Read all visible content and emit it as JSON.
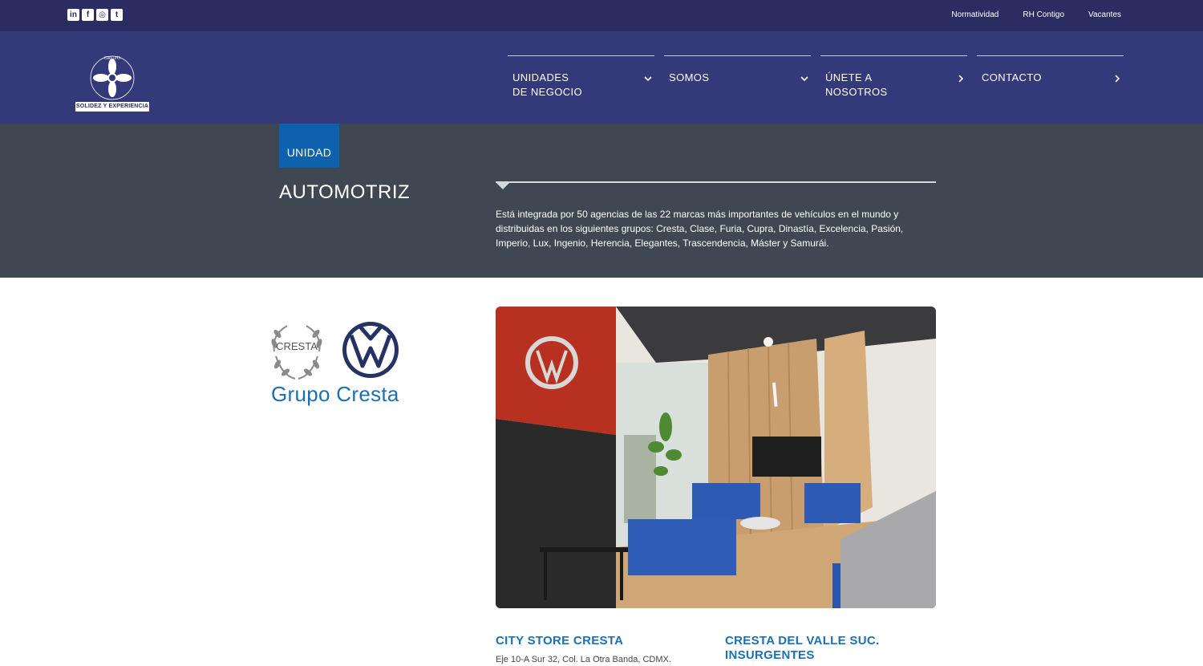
{
  "topbar": {
    "social": [
      {
        "icon": "linkedin-icon",
        "glyph": "in"
      },
      {
        "icon": "facebook-icon",
        "glyph": "f"
      },
      {
        "icon": "instagram-icon",
        "glyph": "◎"
      },
      {
        "icon": "twitter-icon",
        "glyph": "t"
      }
    ],
    "links": [
      "Normatividad",
      "RH Contigo",
      "Vacantes"
    ]
  },
  "header": {
    "logo_arc_text": "GRUPO AUTOFIN MÉXICO",
    "logo_tagline": "SOLIDEZ Y EXPERIENCIA",
    "nav": [
      {
        "label": "UNIDADES\nDE NEGOCIO",
        "chevron": "chevron-down-icon"
      },
      {
        "label": "SOMOS",
        "chevron": "chevron-down-icon"
      },
      {
        "label": "ÚNETE A\nNOSOTROS",
        "chevron": "chevron-right-icon"
      },
      {
        "label": "CONTACTO",
        "chevron": "chevron-right-icon"
      }
    ]
  },
  "unit": {
    "tag": "UNIDAD",
    "title": "AUTOMOTRIZ",
    "description": "Está integrada por 50 agencias de las 22 marcas más importantes de vehículos en el mundo y distribuidas en los siguientes grupos: Cresta, Clase, Furia, Cupra, Dinastía, Excelencia, Pasión, Imperio, Lux, Ingenio, Herencia, Elegantes, Trascendencia, Máster y Samurái."
  },
  "brand": {
    "logo_text": "CRESTA",
    "name": "Grupo Cresta"
  },
  "stores": [
    {
      "name": "CITY STORE CRESTA",
      "address": "Eje 10-A Sur 32, Col. La Otra Banda, CDMX."
    },
    {
      "name": "CRESTA DEL VALLE SUC.\nINSURGENTES",
      "address": ""
    }
  ],
  "colors": {
    "topbar": "#2b2d62",
    "header": "#34397a",
    "band": "#3f4752",
    "accent": "#0e62ad",
    "brand_blue": "#1a6fb5"
  }
}
